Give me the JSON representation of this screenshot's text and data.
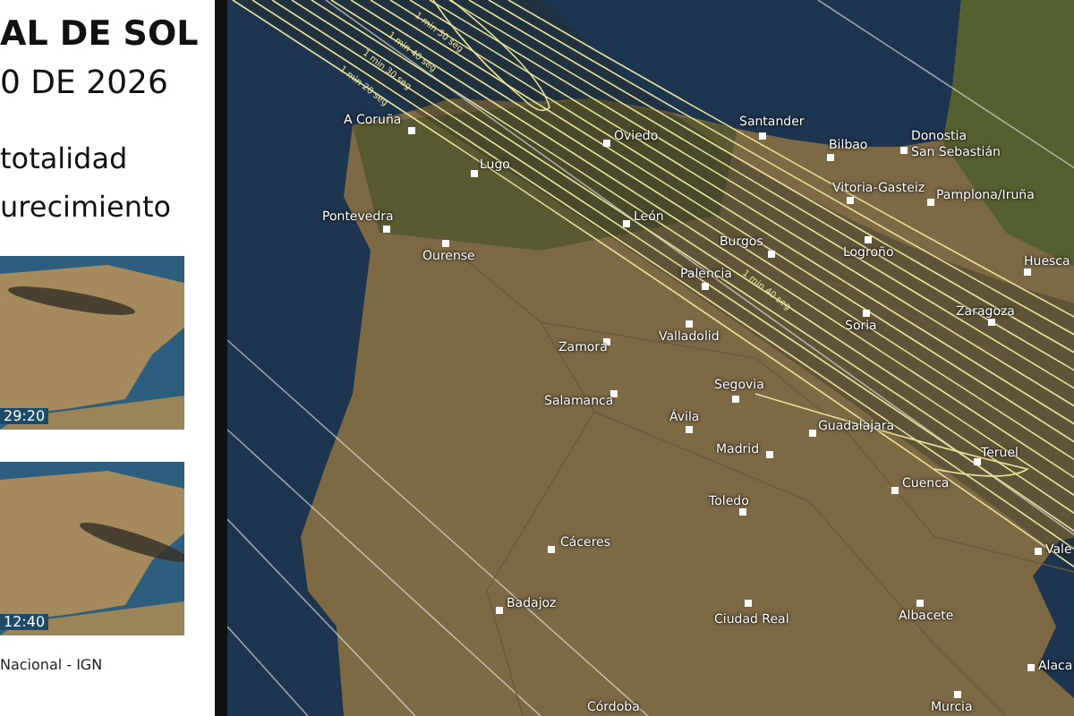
{
  "title": {
    "line1": "AL DE SOL",
    "line2": "0 DE 2026"
  },
  "legend": [
    "totalidad",
    "urecimiento"
  ],
  "thumbnails": [
    {
      "time": "29:20"
    },
    {
      "time": "12:40"
    }
  ],
  "credit": "Nacional - IGN",
  "map": {
    "duration_labels": [
      "1 min 50 seg",
      "1 min 40 seg",
      "1 min 30 seg",
      "1 min 20 seg",
      "1 min 40 seg"
    ],
    "cities": [
      "A Coruña",
      "Oviedo",
      "Lugo",
      "Pontevedra",
      "Ourense",
      "León",
      "Santander",
      "Bilbao",
      "Donostia",
      "San Sebastián",
      "Vitoria-Gasteiz",
      "Pamplona/Iruña",
      "Burgos",
      "Logroño",
      "Palencia",
      "Huesca",
      "Valladolid",
      "Soria",
      "Zaragoza",
      "Zamora",
      "Salamanca",
      "Segovia",
      "Ávila",
      "Guadalajara",
      "Madrid",
      "Teruel",
      "Cuenca",
      "Toledo",
      "Vale",
      "Cáceres",
      "Badajoz",
      "Ciudad Real",
      "Albacete",
      "Alaca",
      "Murcia",
      "Córdoba"
    ]
  }
}
